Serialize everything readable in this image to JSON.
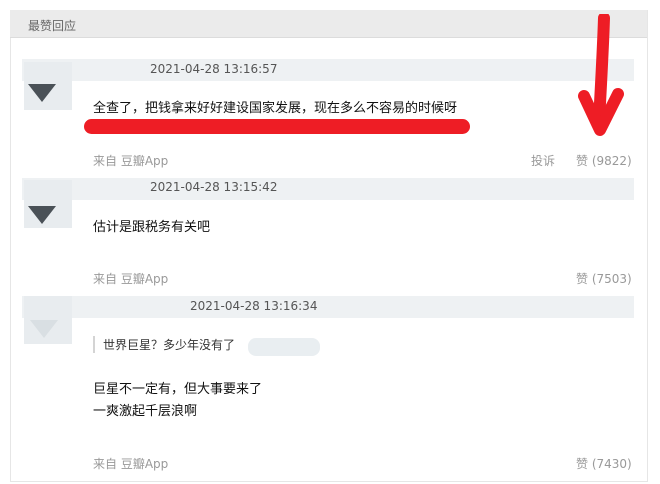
{
  "section": {
    "title": "最赞回应"
  },
  "comments": [
    {
      "timestamp": "2021-04-28 13:16:57",
      "content": "全查了，把钱拿来好好建设国家发展，现在多么不容易的时候呀",
      "source": "来自 豆瓣App",
      "report": "投诉",
      "likes": "赞 (9822)"
    },
    {
      "timestamp": "2021-04-28 13:15:42",
      "content": "估计是跟税务有关吧",
      "source": "来自 豆瓣App",
      "likes": "赞 (7503)"
    },
    {
      "timestamp": "2021-04-28 13:16:34",
      "quote": "世界巨星？多少年没有了",
      "content_line1": "巨星不一定有，但大事要来了",
      "content_line2": "一爽激起千层浪啊",
      "source": "来自 豆瓣App",
      "likes": "赞 (7430)"
    }
  ],
  "annotation": {
    "arrow_color": "#ee1d25",
    "underline_color": "#ee1d25"
  }
}
